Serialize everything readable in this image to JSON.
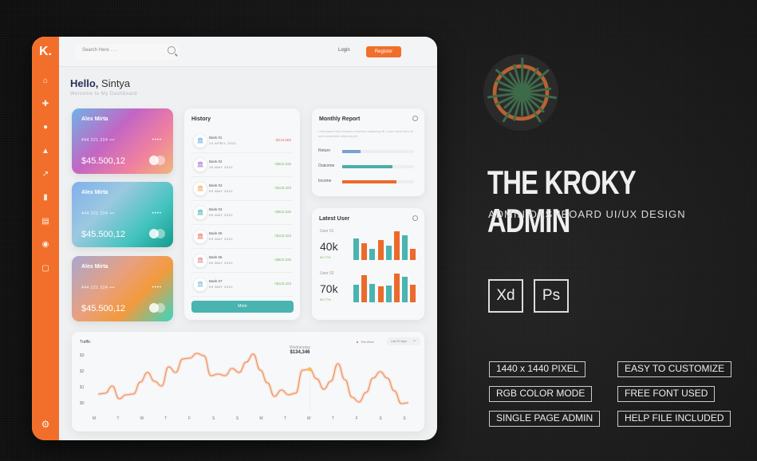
{
  "dashboard": {
    "logo": "K.",
    "sidebar_icons": [
      "home-icon",
      "puzzle-icon",
      "user-icon",
      "bell-icon",
      "growth-chart-icon",
      "bar-chart-icon",
      "document-icon",
      "donut-icon",
      "clipboard-icon"
    ],
    "settings_icon": "gear-icon",
    "search": {
      "placeholder": "Search Here . . ."
    },
    "login_label": "Login",
    "register_label": "Register",
    "greeting": {
      "hello": "Hello,",
      "name": "Sintya",
      "subtitle": "Welcome to My Dashboard"
    },
    "cards": [
      {
        "holder": "Alex Mirta",
        "number": "444 221 224 •••",
        "dots": "••••",
        "balance": "$45.500,12"
      },
      {
        "holder": "Alex Mirta",
        "number": "444 221 224 •••",
        "dots": "••••",
        "balance": "$45.500,12"
      },
      {
        "holder": "Alex Mirta",
        "number": "444 221 224 •••",
        "dots": "••••",
        "balance": "$45.500,12"
      }
    ],
    "history": {
      "title": "History",
      "items": [
        {
          "bank": "Bank 01",
          "date": "14 APRIL 2021",
          "amount": "-$134,683",
          "color": "#6aa8d8"
        },
        {
          "bank": "Bank 02",
          "date": "16 MAY 2021",
          "amount": "+$622,346",
          "color": "#a46ad0"
        },
        {
          "bank": "Bank 03",
          "date": "09 MAY 2021",
          "amount": "+$125,323",
          "color": "#f0a45a"
        },
        {
          "bank": "Bank 04",
          "date": "06 MAY 2021",
          "amount": "+$622,346",
          "color": "#3ab0a8"
        },
        {
          "bank": "Bank 05",
          "date": "09 MAY 2021",
          "amount": "+$122,323",
          "color": "#ef6a5a"
        },
        {
          "bank": "Bank 06",
          "date": "06 MAY 2021",
          "amount": "+$622,346",
          "color": "#e2808e"
        },
        {
          "bank": "Bank 07",
          "date": "09 MAY 2021",
          "amount": "+$122,323",
          "color": "#7ab8e0"
        }
      ],
      "more_label": "More"
    },
    "monthly_report": {
      "title": "Monthly Report",
      "description": "Lorem ipsum dolor sit amet consectetur adipiscing elit. Lorem ipsum dolor sit amet consectetur adipiscing elit.",
      "rows": [
        {
          "label": "Return",
          "value": 0.25,
          "color": "#7b9fd4"
        },
        {
          "label": "Outcome",
          "value": 0.7,
          "color": "#4aaea8"
        },
        {
          "label": "Income",
          "value": 0.75,
          "color": "#ec6a2c"
        }
      ]
    },
    "latest_user": {
      "title": "Latest User",
      "users": [
        {
          "label": "User 01",
          "value": "40k",
          "percent": "69.77%",
          "bars": [
            0.75,
            0.58,
            0.4,
            0.7,
            0.5,
            1.0,
            0.85,
            0.38
          ]
        },
        {
          "label": "User 02",
          "value": "70k",
          "percent": "69.77%",
          "bars": [
            0.6,
            0.95,
            0.65,
            0.55,
            0.58,
            1.0,
            0.88,
            0.62
          ]
        }
      ],
      "bar_colors": [
        "#49b4b0",
        "#ec6a2c"
      ]
    },
    "traffic": {
      "title": "Traffic",
      "legend": "This Week",
      "range": "Last 30 days",
      "y_ticks": [
        "$3",
        "$2",
        "$1",
        "$0"
      ],
      "x_ticks": [
        "M",
        "T",
        "W",
        "T",
        "F",
        "S",
        "S",
        "M",
        "T",
        "W",
        "T",
        "F",
        "S",
        "S"
      ],
      "tooltip": {
        "day": "Wednesday",
        "value": "$134,346"
      },
      "series": [
        0.7,
        0.75,
        1.2,
        0.4,
        0.65,
        0.7,
        1.45,
        2.05,
        1.5,
        1.2,
        2.4,
        2.05,
        2.9,
        2.95,
        3.25,
        3.1,
        1.85,
        1.95,
        1.85,
        2.3,
        2.05,
        2.7,
        3.2,
        2.2,
        1.4,
        0.55,
        0.95,
        0.65,
        0.75,
        2.2,
        2.25,
        1.65,
        1.0,
        1.5,
        2.6,
        1.6,
        0.5,
        0.2,
        0.8,
        1.7,
        2.1,
        1.7,
        0.9,
        0.1,
        0.15
      ]
    }
  },
  "promo": {
    "title": "THE KROKY ADMIN",
    "subtitle": "ADMIN DASHBOARD UI/UX DESIGN",
    "software": [
      "Xd",
      "Ps"
    ],
    "features": [
      "1440 x 1440 PIXEL",
      "EASY TO CUSTOMIZE",
      "RGB COLOR MODE",
      "FREE FONT USED",
      "SINGLE PAGE ADMIN",
      "HELP FILE INCLUDED"
    ]
  }
}
